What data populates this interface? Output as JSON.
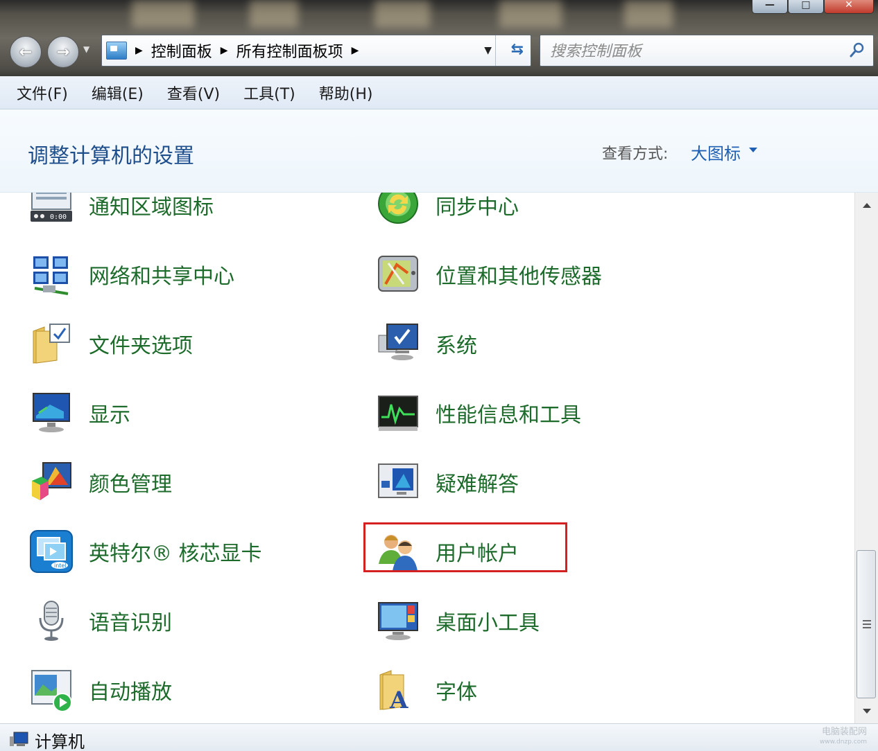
{
  "address_bar": {
    "crumbs": [
      "控制面板",
      "所有控制面板项"
    ]
  },
  "search": {
    "placeholder": "搜索控制面板"
  },
  "menu": {
    "items": [
      "文件(F)",
      "编辑(E)",
      "查看(V)",
      "工具(T)",
      "帮助(H)"
    ]
  },
  "header": {
    "title": "调整计算机的设置",
    "view_by_label": "查看方式:",
    "view_by_value": "大图标"
  },
  "items": [
    {
      "label": "通知区域图标",
      "icon": "notification-area-icon"
    },
    {
      "label": "同步中心",
      "icon": "sync-center-icon"
    },
    {
      "label": "网络和共享中心",
      "icon": "network-sharing-icon"
    },
    {
      "label": "位置和其他传感器",
      "icon": "location-sensors-icon"
    },
    {
      "label": "文件夹选项",
      "icon": "folder-options-icon"
    },
    {
      "label": "系统",
      "icon": "system-icon"
    },
    {
      "label": "显示",
      "icon": "display-icon"
    },
    {
      "label": "性能信息和工具",
      "icon": "performance-icon"
    },
    {
      "label": "颜色管理",
      "icon": "color-management-icon"
    },
    {
      "label": "疑难解答",
      "icon": "troubleshooting-icon"
    },
    {
      "label": "英特尔® 核芯显卡",
      "icon": "intel-graphics-icon"
    },
    {
      "label": "用户帐户",
      "icon": "user-accounts-icon",
      "highlighted": true
    },
    {
      "label": "语音识别",
      "icon": "microphone-icon"
    },
    {
      "label": "桌面小工具",
      "icon": "desktop-gadgets-icon"
    },
    {
      "label": "自动播放",
      "icon": "autoplay-icon"
    },
    {
      "label": "字体",
      "icon": "fonts-icon"
    }
  ],
  "status_bar": {
    "text": "计算机"
  },
  "watermark": {
    "line1": "电脑装配网",
    "line2": "www.dnzp.com"
  },
  "colors": {
    "item_label": "#1d6b2b",
    "title": "#1e4e8c",
    "link": "#1e5fb4",
    "highlight_border": "#d42020"
  }
}
